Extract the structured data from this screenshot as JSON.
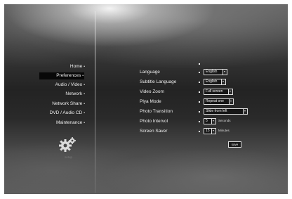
{
  "menu": {
    "items": [
      {
        "label": "Home"
      },
      {
        "label": "Preferences"
      },
      {
        "label": "Audio / Video"
      },
      {
        "label": "Network"
      },
      {
        "label": "Network Share"
      },
      {
        "label": "DVD / Audio  CD"
      },
      {
        "label": "Maintenance"
      }
    ],
    "selected": "Preferences",
    "dot": "•",
    "icon": "gear-icon",
    "icon_caption": "setup"
  },
  "preferences": {
    "language": {
      "label": "Language",
      "value": "English"
    },
    "subtitle_language": {
      "label": "Subtitle Language",
      "value": "English"
    },
    "video_zoom": {
      "label": "Video Zoom",
      "value": "Full screen"
    },
    "plya_mode": {
      "label": "Plya Mode",
      "value": "Repeat one"
    },
    "photo_transition": {
      "label": "Photo Transition",
      "value": "Slide from left"
    },
    "photo_interval": {
      "label": "Photo Intervol",
      "value": "5",
      "unit": "Seconds"
    },
    "screen_saver": {
      "label": "Screen Saver",
      "value": "15",
      "unit": "Minutes"
    }
  },
  "save_label": "save",
  "colors": {
    "selection_bar": "#080808",
    "text": "#eeeeee",
    "box_border": "#dddddd"
  }
}
